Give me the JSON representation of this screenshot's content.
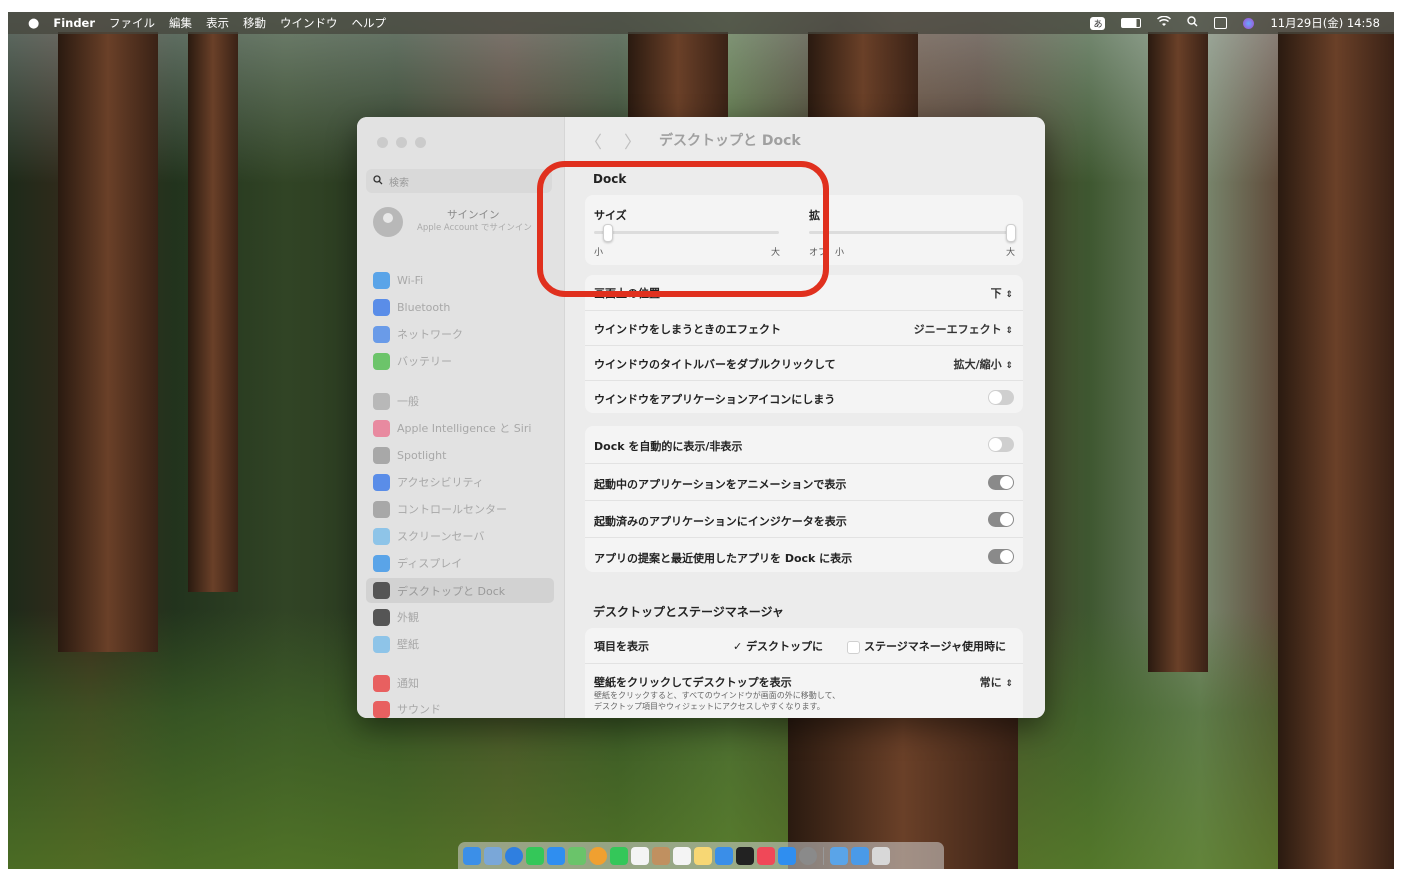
{
  "menubar": {
    "apple": "",
    "app": "Finder",
    "menus": [
      "ファイル",
      "編集",
      "表示",
      "移動",
      "ウインドウ",
      "ヘルプ"
    ],
    "input_badge": "あ",
    "clock": "11月29日(金) 14:58"
  },
  "window": {
    "title": "デスクトップと Dock",
    "back": "〈",
    "forward": "〉"
  },
  "sidebar": {
    "search_placeholder": "検索",
    "account_title": "サインイン",
    "account_sub": "Apple Account でサインイン",
    "items": [
      {
        "label": "Wi-Fi",
        "color": "#5aa4e8"
      },
      {
        "label": "Bluetooth",
        "color": "#5a8de8"
      },
      {
        "label": "ネットワーク",
        "color": "#6a9be8"
      },
      {
        "label": "バッテリー",
        "color": "#6cc46a"
      },
      {
        "label": "一般",
        "color": "#b8b8b8"
      },
      {
        "label": "Apple Intelligence と Siri",
        "color": "#e88aa0"
      },
      {
        "label": "Spotlight",
        "color": "#a8a8a8"
      },
      {
        "label": "アクセシビリティ",
        "color": "#5a8de8"
      },
      {
        "label": "コントロールセンター",
        "color": "#a8a8a8"
      },
      {
        "label": "スクリーンセーバ",
        "color": "#8ec4e8"
      },
      {
        "label": "ディスプレイ",
        "color": "#5aa4e8"
      },
      {
        "label": "デスクトップと Dock",
        "color": "#555555"
      },
      {
        "label": "外観",
        "color": "#555555"
      },
      {
        "label": "壁紙",
        "color": "#8ec4e8"
      },
      {
        "label": "通知",
        "color": "#e86060"
      },
      {
        "label": "サウンド",
        "color": "#e86060"
      }
    ]
  },
  "dock_section": {
    "title": "Dock",
    "size_label": "サイズ",
    "size_min": "小",
    "size_max": "大",
    "size_value": 0.05,
    "mag_label": "拡",
    "mag_off": "オフ",
    "mag_min": "小",
    "mag_max": "大",
    "mag_value": 1.0,
    "position_label": "画面上の位置",
    "position_value": "下",
    "effect_label": "ウインドウをしまうときのエフェクト",
    "effect_value": "ジニーエフェクト",
    "dblclick_label": "ウインドウのタイトルバーをダブルクリックして",
    "dblclick_value": "拡大/縮小",
    "minimize_app_label": "ウインドウをアプリケーションアイコンにしまう",
    "autohide_label": "Dock を自動的に表示/非表示",
    "animate_label": "起動中のアプリケーションをアニメーションで表示",
    "indicator_label": "起動済みのアプリケーションにインジケータを表示",
    "suggest_label": "アプリの提案と最近使用したアプリを Dock に表示"
  },
  "desktop_section": {
    "title": "デスクトップとステージマネージャ",
    "show_items_label": "項目を表示",
    "opt_desktop": "デスクトップに",
    "opt_stage": "ステージマネージャ使用時に",
    "click_wallpaper_label": "壁紙をクリックしてデスクトップを表示",
    "click_wallpaper_value": "常に",
    "desc_line1": "壁紙をクリックすると、すべてのウインドウが画面の外に移動して、",
    "desc_line2": "デスクトップ項目やウィジェットにアクセスしやすくなります。"
  },
  "dock_apps": [
    "finder",
    "launchpad",
    "safari",
    "messages",
    "mail",
    "maps",
    "photos",
    "facetime",
    "calendar",
    "contacts",
    "reminders",
    "notes",
    "freeform",
    "tv",
    "music",
    "appstore",
    "settings",
    "separator",
    "preview",
    "folder",
    "trash"
  ]
}
